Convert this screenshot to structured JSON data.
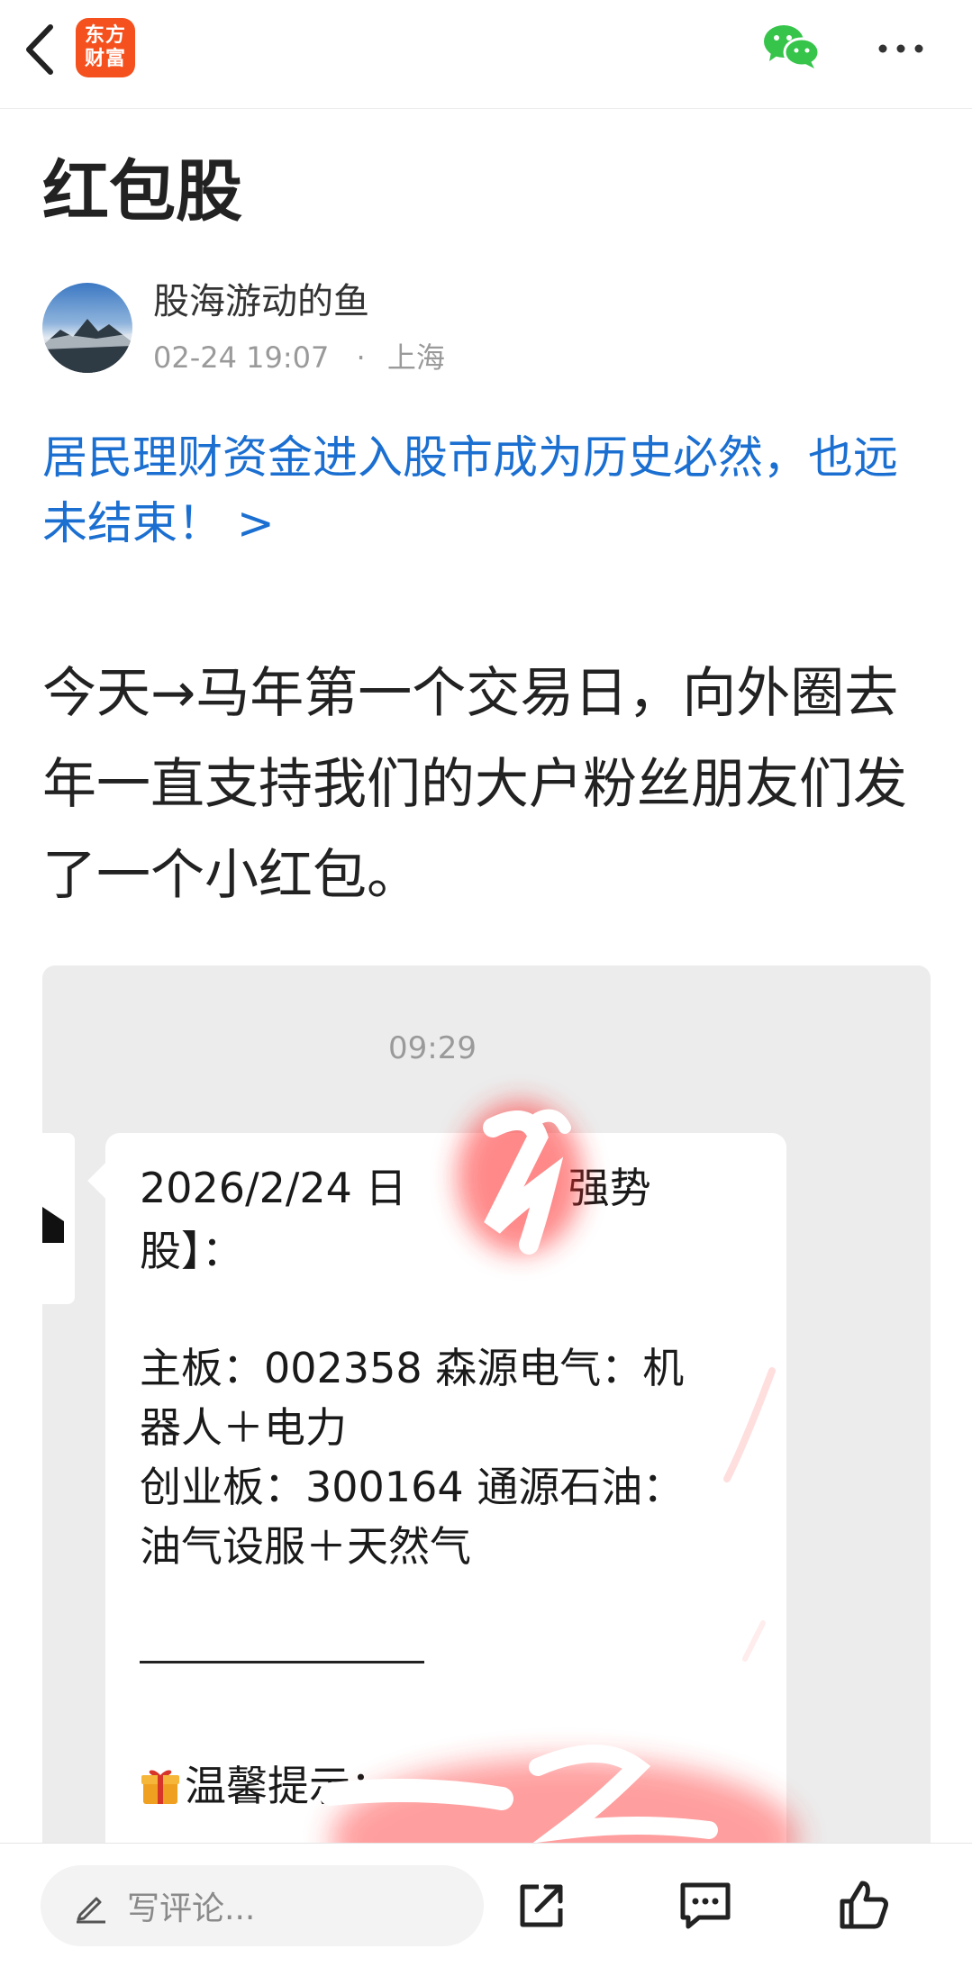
{
  "app": {
    "logo_line1": "东方",
    "logo_line2": "财富",
    "brand_color": "#f4511e"
  },
  "article": {
    "title": "红包股",
    "author": "股海游动的鱼",
    "timestamp": "02-24 19:07",
    "separator": "·",
    "location": "上海",
    "promo_link": "居民理财资金进入股市成为历史必然，也远未结束！ >",
    "body": "今天→马年第一个交易日，向外圈去年一直支持我们的大户粉丝朋友们发了一个小红包。"
  },
  "chat_image": {
    "time": "09:29",
    "line1": "2026/2/24 日",
    "line1_tail": "强势",
    "line2": "股】：",
    "board_main": "主板：002358 森源电气：机",
    "board_main_more": "器人＋电力",
    "board_chuang": "创业板：300164 通源石油：",
    "board_chuang_more": "油气设服＋天然气",
    "tip": "温馨提示："
  },
  "bottom_bar": {
    "comment_placeholder": "写评论..."
  },
  "icons": {
    "back": "chevron-left-icon",
    "wechat": "wechat-icon",
    "more": "more-dots-icon",
    "pen": "pen-icon",
    "share": "share-icon",
    "comments": "comments-icon",
    "like": "thumbs-up-icon",
    "gift": "gift-icon"
  },
  "colors": {
    "link": "#1b6fd1",
    "wechat_green": "#36c44a"
  }
}
